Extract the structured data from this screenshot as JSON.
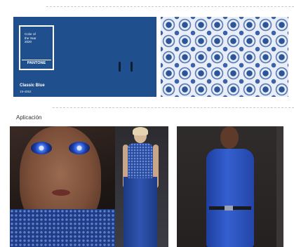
{
  "pantone_card": {
    "swatch_lines": [
      "Color of",
      "the Year",
      "2020"
    ],
    "brand": "PANTONE",
    "color_name": "Classic Blue",
    "color_code": "19-4052",
    "colors": {
      "card": "#1f4f8c",
      "text": "#ffffff"
    }
  },
  "pattern_tile": {
    "icon": "blue-tile-pattern",
    "colors": [
      "#e8edf6",
      "#2c5498",
      "#5a7dbc"
    ]
  },
  "section": {
    "label": "Aplicación"
  },
  "photos": [
    {
      "icon": "makeup-face-photo"
    },
    {
      "icon": "runway-dress-photo"
    },
    {
      "icon": "blue-outfit-model-photo"
    }
  ]
}
